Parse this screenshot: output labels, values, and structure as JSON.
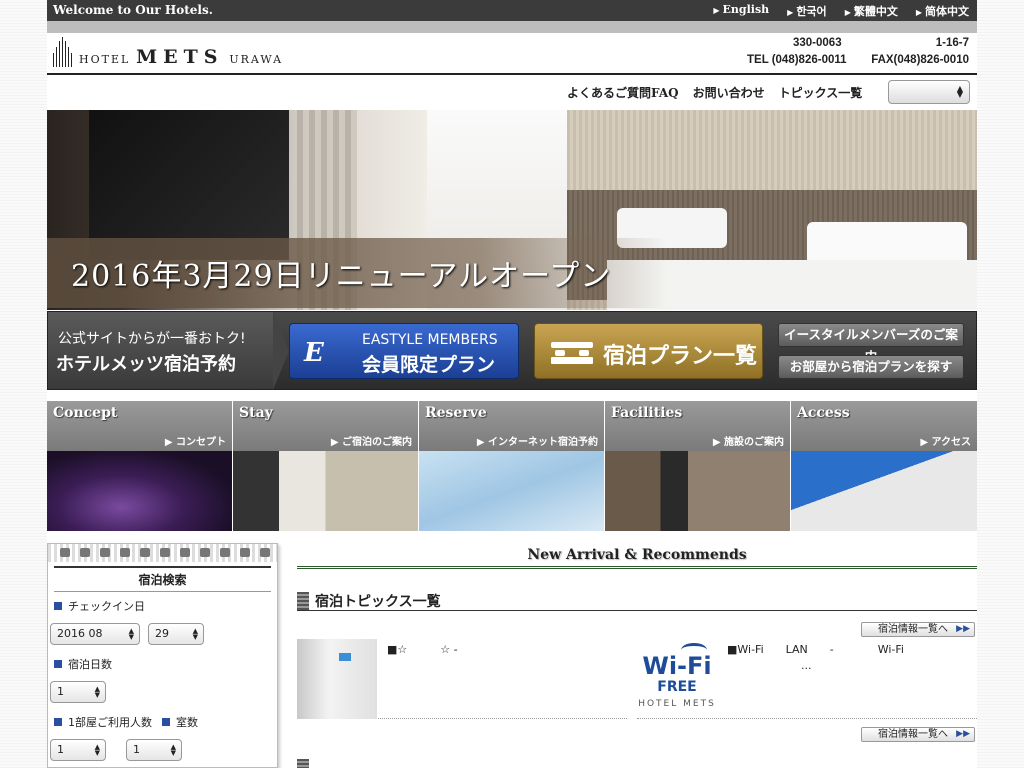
{
  "topbar": {
    "welcome": "Welcome to Our Hotels.",
    "languages": [
      "English",
      "한국어",
      "繁體中文",
      "简体中文"
    ]
  },
  "header": {
    "logo_hotel": "HOTEL",
    "logo_mets": "METS",
    "logo_urawa": "URAWA",
    "postal_code": "330-0063",
    "address_no": "1-16-7",
    "tel": "TEL (048)826-0011",
    "fax": "FAX(048)826-0010"
  },
  "nav": {
    "links": [
      "よくあるご質問FAQ",
      "お問い合わせ",
      "トピックス一覧"
    ],
    "select_value": ""
  },
  "hero": {
    "caption": "2016年3月29日リニューアルオープン"
  },
  "reserve": {
    "line1": "公式サイトからが一番おトク!",
    "line2": "ホテルメッツ宿泊予約",
    "members_en": "EASTYLE MEMBERS",
    "members_jp": "会員限定プラン",
    "plans": "宿泊プラン一覧",
    "btn_members_info": "イースタイルメンバーズのご案内",
    "btn_room_search": "お部屋から宿泊プランを探す"
  },
  "tiles": [
    {
      "en": "Concept",
      "jp": "▶ コンセプト"
    },
    {
      "en": "Stay",
      "jp": "▶ ご宿泊のご案内"
    },
    {
      "en": "Reserve",
      "jp": "▶ インターネット宿泊予約"
    },
    {
      "en": "Facilities",
      "jp": "▶ 施設のご案内"
    },
    {
      "en": "Access",
      "jp": "▶ アクセス"
    }
  ],
  "search": {
    "title": "宿泊検索",
    "checkin_label": "チェックイン日",
    "checkin_year_month": "2016 08",
    "checkin_day": "29",
    "nights_label": "宿泊日数",
    "nights_value": "1",
    "guests_label": "1部屋ご利用人数",
    "rooms_label": "室数",
    "guests_value": "1",
    "rooms_value": "1"
  },
  "main": {
    "section_title": "New Arrival & Recommends",
    "topics_title": "宿泊トピックス一覧",
    "more_label": "宿泊情報一覧へ",
    "more_arrow": "▶▶",
    "item1_text": "■☆　　　☆ -",
    "item2_text": "■Wi-Fi　　LAN　　-　　　　Wi-Fi",
    "item2_ellipsis": "...",
    "wifi_word": "Wi-Fi",
    "wifi_free": "FREE",
    "wifi_hotel": "HOTEL METS"
  }
}
